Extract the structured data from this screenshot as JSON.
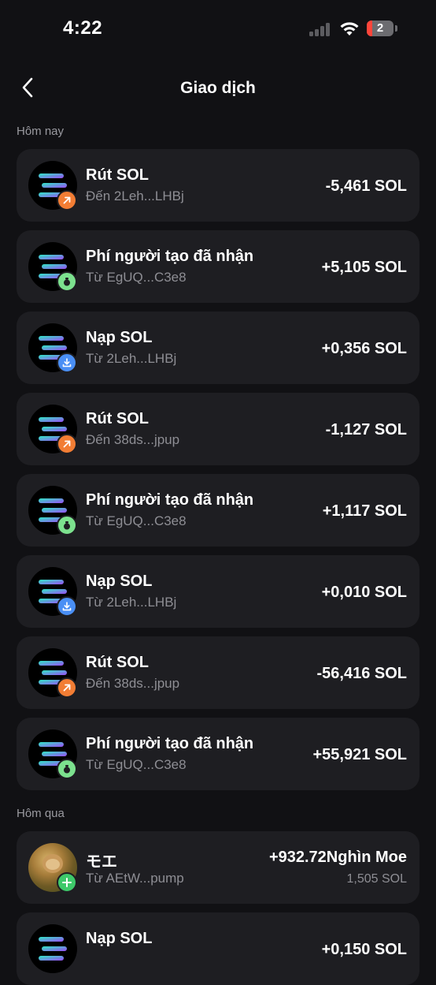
{
  "status": {
    "time": "4:22",
    "battery": "2"
  },
  "nav": {
    "title": "Giao dịch"
  },
  "sections": {
    "today": "Hôm nay",
    "yesterday": "Hôm qua"
  },
  "transactions": [
    {
      "title": "Rút SOL",
      "subtitle": "Đến 2Leh...LHBj",
      "amount": "-5,461 SOL",
      "type": "withdraw",
      "icon": "arrow-up-right-icon"
    },
    {
      "title": "Phí người tạo đã nhận",
      "subtitle": "Từ EgUQ...C3e8",
      "amount": "+5,105 SOL",
      "type": "creator-fee",
      "icon": "money-bag-icon"
    },
    {
      "title": "Nạp SOL",
      "subtitle": "Từ 2Leh...LHBj",
      "amount": "+0,356 SOL",
      "type": "deposit",
      "icon": "download-icon"
    },
    {
      "title": "Rút SOL",
      "subtitle": "Đến 38ds...jpup",
      "amount": "-1,127 SOL",
      "type": "withdraw",
      "icon": "arrow-up-right-icon"
    },
    {
      "title": "Phí người tạo đã nhận",
      "subtitle": "Từ EgUQ...C3e8",
      "amount": "+1,117 SOL",
      "type": "creator-fee",
      "icon": "money-bag-icon"
    },
    {
      "title": "Nạp SOL",
      "subtitle": "Từ 2Leh...LHBj",
      "amount": "+0,010 SOL",
      "type": "deposit",
      "icon": "download-icon"
    },
    {
      "title": "Rút SOL",
      "subtitle": "Đến 38ds...jpup",
      "amount": "-56,416 SOL",
      "type": "withdraw",
      "icon": "arrow-up-right-icon"
    },
    {
      "title": "Phí người tạo đã nhận",
      "subtitle": "Từ EgUQ...C3e8",
      "amount": "+55,921 SOL",
      "type": "creator-fee",
      "icon": "money-bag-icon"
    }
  ],
  "yesterday_transactions": [
    {
      "title": "モエ",
      "subtitle": "Từ AEtW...pump",
      "amount": "+932.72Nghìn Moe",
      "amount_secondary": "1,505 SOL",
      "type": "token-receive",
      "icon": "plus-icon"
    },
    {
      "title": "Nạp SOL",
      "amount": "+0,150 SOL",
      "type": "deposit",
      "icon": "download-icon"
    }
  ],
  "colors": {
    "background": "#111114",
    "card": "#1e1e22",
    "withdraw_badge": "#f27d34",
    "fee_badge": "#7ce18e",
    "deposit_badge": "#4a8ff5",
    "plus_badge": "#3ec96a",
    "muted_text": "#8e8e94"
  }
}
